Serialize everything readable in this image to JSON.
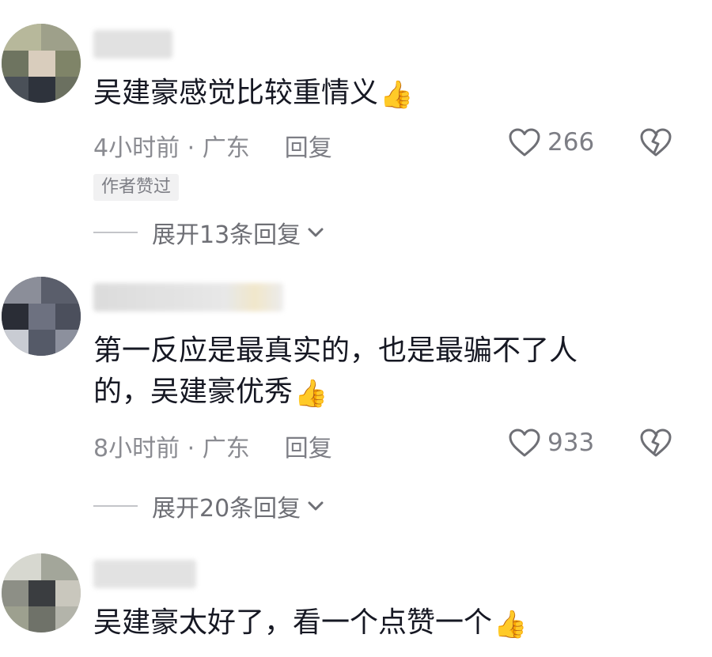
{
  "comments": [
    {
      "text": "吴建豪感觉比较重情义",
      "emoji": "👍",
      "time_location": "4小时前 · 广东",
      "reply_label": "回复",
      "like_count": "266",
      "badge": "作者赞过",
      "expand_label": "展开13条回复"
    },
    {
      "text_line1": "第一反应是最真实的，也是最骗不了人",
      "text_line2": "的，吴建豪优秀",
      "emoji": "👍",
      "time_location": "8小时前 · 广东",
      "reply_label": "回复",
      "like_count": "933",
      "expand_label": "展开20条回复"
    },
    {
      "text": "吴建豪太好了，看一个点赞一个",
      "emoji": "👍"
    }
  ],
  "icons": {
    "like": "heart-outline-icon",
    "dislike": "broken-heart-icon",
    "expand": "chevron-down-icon"
  },
  "colors": {
    "text": "#161823",
    "meta": "#8a8b91",
    "badge_bg": "#f1f1f2"
  }
}
